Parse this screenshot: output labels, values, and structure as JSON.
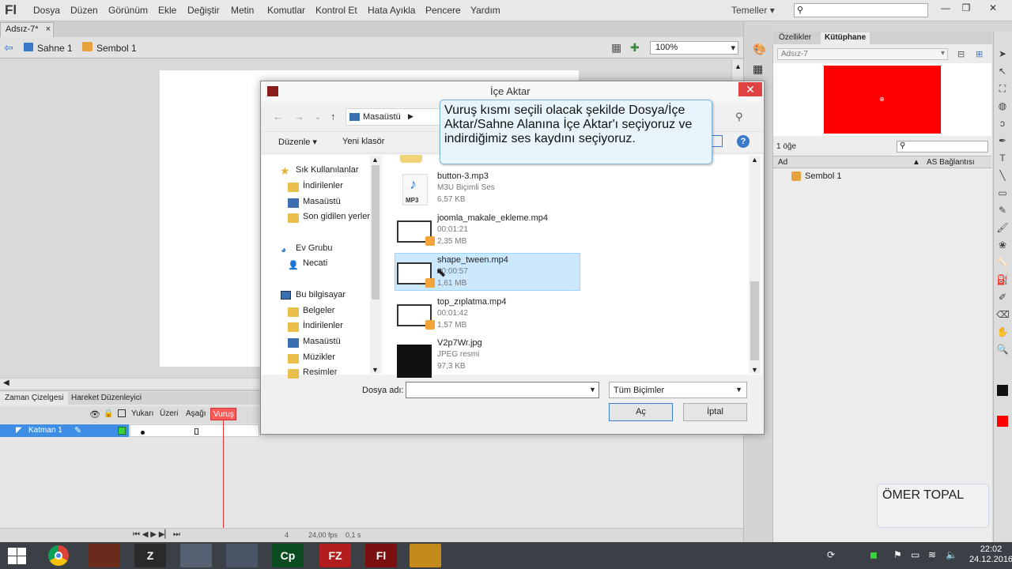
{
  "app": {
    "logo": "Fl",
    "menus": [
      "Dosya",
      "Düzen",
      "Görünüm",
      "Ekle",
      "Değiştir",
      "Metin",
      "Komutlar",
      "Kontrol Et",
      "Hata Ayıkla",
      "Pencere",
      "Yardım"
    ],
    "workspace_label": "Temeller",
    "doc_tab": "Adsız-7*",
    "scene_label": "Sahne 1",
    "symbol_label": "Sembol 1",
    "zoom": "100%"
  },
  "timeline": {
    "tabs": [
      "Zaman Çizelgesi",
      "Hareket Düzenleyici"
    ],
    "frame_labels": [
      "Yukarı",
      "Üzeri",
      "Aşağı"
    ],
    "current_frame_label": "Vuruş",
    "layer_name": "Katman 1",
    "footer": {
      "frame": "4",
      "fps": "24,00 fps",
      "time": "0,1 s"
    }
  },
  "library": {
    "tabs": [
      "Özellikler",
      "Kütüphane"
    ],
    "document": "Adsız-7",
    "count": "1 öğe",
    "col_name": "Ad",
    "col_linkage": "AS Bağlantısı",
    "item": "Sembol 1",
    "preview_color": "#ff0000"
  },
  "dialog": {
    "title": "İçe Aktar",
    "address": "Masaüstü",
    "organize": "Düzenle",
    "new_folder": "Yeni klasör",
    "nav": [
      {
        "label": "Sık Kullanılanlar",
        "kind": "star"
      },
      {
        "label": "İndirilenler",
        "kind": "folder"
      },
      {
        "label": "Masaüstü",
        "kind": "desktop"
      },
      {
        "label": "Son gidilen yerler",
        "kind": "folder"
      },
      {
        "label": "Ev Grubu",
        "kind": "group"
      },
      {
        "label": "Necati",
        "kind": "user"
      },
      {
        "label": "Bu bilgisayar",
        "kind": "pc"
      },
      {
        "label": "Belgeler",
        "kind": "folder"
      },
      {
        "label": "İndirilenler",
        "kind": "folder"
      },
      {
        "label": "Masaüstü",
        "kind": "desktop"
      },
      {
        "label": "Müzikler",
        "kind": "folder"
      },
      {
        "label": "Resimler",
        "kind": "folder"
      }
    ],
    "files": [
      {
        "name": "button-3.mp3",
        "line2": "M3U Biçimli Ses",
        "line3": "6,57 KB",
        "kind": "mp3",
        "thumb_text": "MP3"
      },
      {
        "name": "joomla_makale_ekleme.mp4",
        "line2": "00:01:21",
        "line3": "2,35 MB",
        "kind": "video"
      },
      {
        "name": "shape_tween.mp4",
        "line2": "00:00:57",
        "line3": "1,61 MB",
        "kind": "video",
        "selected": true
      },
      {
        "name": "top_zıplatma.mp4",
        "line2": "00:01:42",
        "line3": "1,57 MB",
        "kind": "video"
      },
      {
        "name": "V2p7Wr.jpg",
        "line2": "JPEG resmi",
        "line3": "97,3 KB",
        "kind": "jpg"
      }
    ],
    "filename_label": "Dosya adı:",
    "filename_value": "",
    "filter": "Tüm Biçimler",
    "open_button": "Aç",
    "cancel_button": "İptal"
  },
  "callout": "Vuruş kısmı seçili olacak şekilde Dosya/İçe Aktar/Sahne Alanına İçe Aktar'ı seçiyoruz ve indirdiğimiz ses kaydını seçiyoruz.",
  "watermark": "ÖMER TOPAL",
  "taskbar": {
    "time": "22:02",
    "date": "24.12.2016",
    "apps": [
      {
        "name": "chrome",
        "label": "",
        "color": "#3b3f46"
      },
      {
        "name": "app-2",
        "label": "",
        "color": "#6a2b1c"
      },
      {
        "name": "app-3",
        "label": "Z",
        "color": "#2a2a2a"
      },
      {
        "name": "app-4",
        "label": "",
        "color": "#556070"
      },
      {
        "name": "app-5",
        "label": "",
        "color": "#4a5568"
      },
      {
        "name": "captivate",
        "label": "Cp",
        "color": "#0a4b1f"
      },
      {
        "name": "filezilla",
        "label": "FZ",
        "color": "#b21d1d"
      },
      {
        "name": "flash",
        "label": "Fl",
        "color": "#7a1010"
      },
      {
        "name": "app-9",
        "label": "",
        "color": "#c48a1c"
      }
    ]
  }
}
